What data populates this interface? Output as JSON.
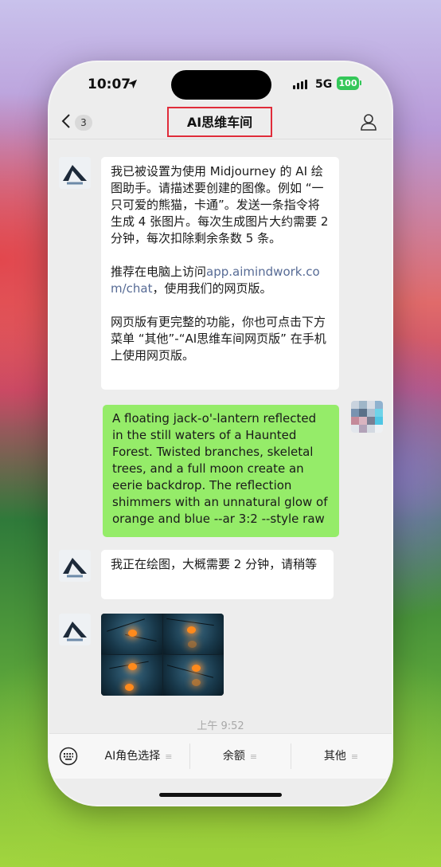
{
  "status_bar": {
    "time": "10:07",
    "network": "5G",
    "battery": "100"
  },
  "nav": {
    "back_count": "3",
    "title": "AI思维车间"
  },
  "messages": [
    {
      "from": "bot",
      "paragraphs": [
        "我已被设置为使用 Midjourney 的 AI 绘图助手。请描述要创建的图像。例如 “一只可爱的熊猫，卡通”。发送一条指令将生成 4 张图片。每次生成图片大约需要 2 分钟，每次扣除剩余条数 5 条。",
        "推荐在电脑上访问",
        "app.aimindwork.com/chat",
        "，使用我们的网页版。",
        "网页版有更完整的功能，你也可点击下方菜单 “其他”-“AI思维车间网页版” 在手机上使用网页版。"
      ]
    },
    {
      "from": "user",
      "text": "A floating jack-o'-lantern reflected in the still waters of a Haunted Forest. Twisted branches, skeletal trees, and a full moon create an eerie backdrop. The reflection shimmers with an unnatural glow of orange and blue --ar 3:2 --style raw"
    },
    {
      "from": "bot",
      "text": "我正在绘图，大概需要 2 分钟，请稍等"
    },
    {
      "from": "bot",
      "type": "image-grid"
    }
  ],
  "timestamp": "上午 9:52",
  "bottom_menu": [
    "AI角色选择",
    "余额",
    "其他"
  ],
  "colors": {
    "user_bubble": "#95ec69",
    "link": "#576b95",
    "title_highlight": "#e02c3a",
    "battery": "#34c759"
  }
}
